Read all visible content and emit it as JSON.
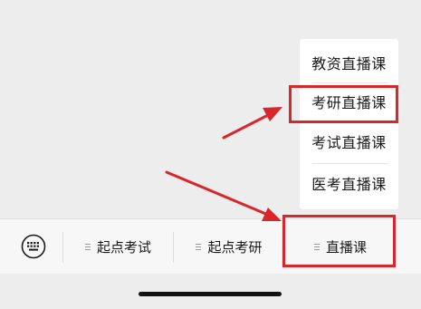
{
  "popup_menu": {
    "items": [
      {
        "label": "教资直播课"
      },
      {
        "label": "考研直播课"
      },
      {
        "label": "考试直播课"
      },
      {
        "label": "医考直播课"
      }
    ]
  },
  "bottom_bar": {
    "keyboard_icon": "keyboard-icon",
    "tabs": [
      {
        "label": "起点考试",
        "icon": "menu-lines-icon"
      },
      {
        "label": "起点考研",
        "icon": "menu-lines-icon"
      },
      {
        "label": "直播课",
        "icon": "menu-lines-icon"
      }
    ]
  },
  "annotations": {
    "highlight_color": "#d9262b",
    "highlighted_items": [
      "考研直播课",
      "直播课"
    ]
  }
}
